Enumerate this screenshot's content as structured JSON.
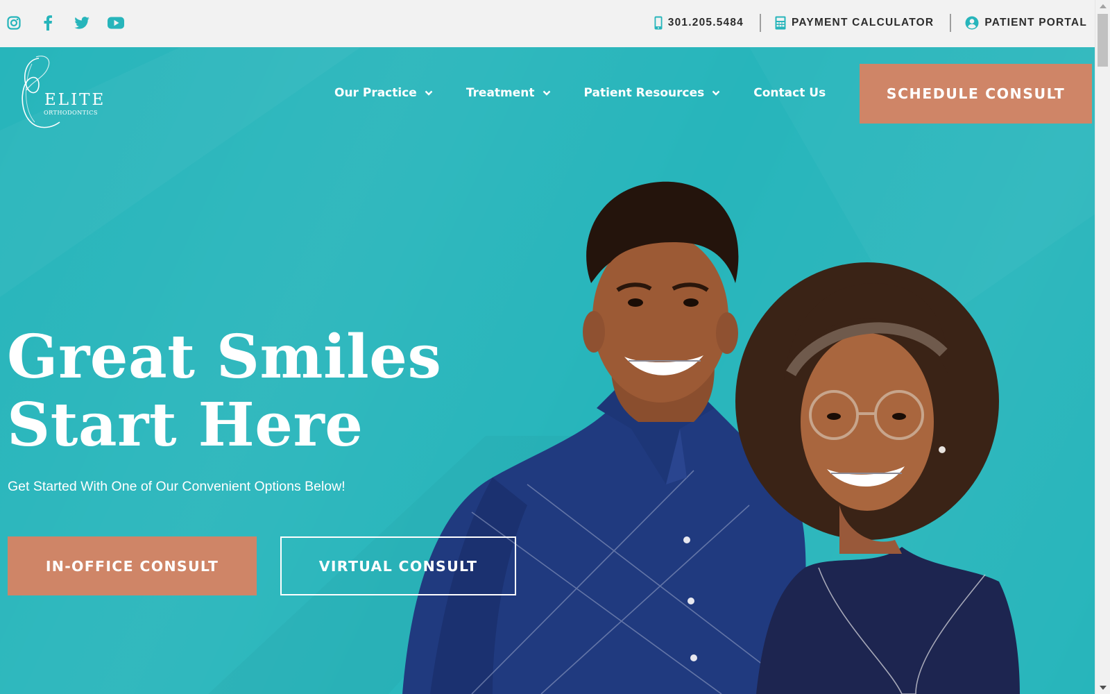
{
  "colors": {
    "teal": "#27b5bb",
    "accent": "#cf8567",
    "topbar_bg": "#f2f2f2",
    "icon_teal": "#27b5bb",
    "utility_text": "#2c2c2c"
  },
  "social": [
    {
      "icon": "instagram-icon"
    },
    {
      "icon": "facebook-icon"
    },
    {
      "icon": "twitter-icon"
    },
    {
      "icon": "youtube-icon"
    }
  ],
  "utility": {
    "phone": {
      "icon": "mobile-phone-icon",
      "label": "301.205.5484"
    },
    "calculator": {
      "icon": "calculator-icon",
      "label": "PAYMENT CALCULATOR"
    },
    "portal": {
      "icon": "user-circle-icon",
      "label": "PATIENT PORTAL"
    }
  },
  "logo": {
    "line1": "ELITE",
    "line2": "ORTHODONTICS"
  },
  "nav": [
    {
      "label": "Our Practice",
      "has_dropdown": true
    },
    {
      "label": "Treatment",
      "has_dropdown": true
    },
    {
      "label": "Patient Resources",
      "has_dropdown": true
    },
    {
      "label": "Contact Us",
      "has_dropdown": false
    }
  ],
  "cta": {
    "schedule": "SCHEDULE CONSULT"
  },
  "hero": {
    "headline_line1": "Great Smiles",
    "headline_line2": "Start Here",
    "subline": "Get Started With One of Our Convenient Options Below!",
    "button_in_office": "IN-OFFICE CONSULT",
    "button_virtual": "VIRTUAL CONSULT"
  }
}
